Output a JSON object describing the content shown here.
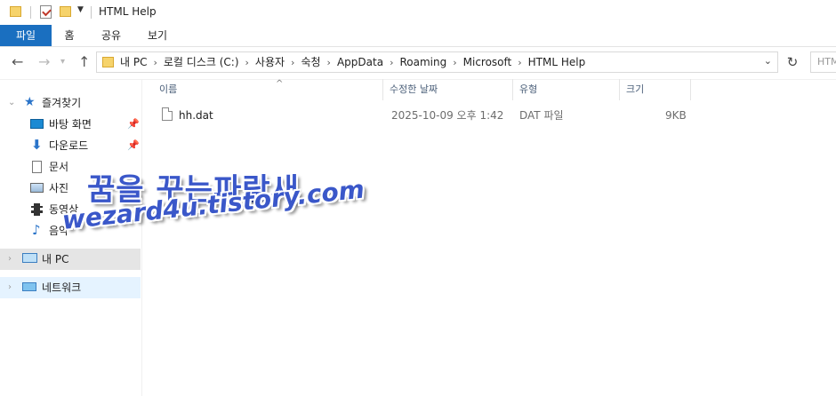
{
  "window": {
    "title": "HTML Help"
  },
  "ribbon": {
    "tabs": [
      "파일",
      "홈",
      "공유",
      "보기"
    ]
  },
  "address": {
    "crumbs": [
      "내 PC",
      "로컬 디스크 (C:)",
      "사용자",
      "숙청",
      "AppData",
      "Roaming",
      "Microsoft",
      "HTML Help"
    ],
    "search_placeholder": "HTML Help 검색"
  },
  "sidebar": {
    "quick_access": "즐겨찾기",
    "items": [
      "바탕 화면",
      "다운로드",
      "문서",
      "사진",
      "동영상",
      "음악"
    ],
    "this_pc": "내 PC",
    "network": "네트워크"
  },
  "columns": {
    "name": "이름",
    "modified": "수정한 날짜",
    "type": "유형",
    "size": "크기"
  },
  "files": [
    {
      "name": "hh.dat",
      "modified": "2025-10-09 오후 1:42",
      "type": "DAT 파일",
      "size": "9KB"
    }
  ],
  "watermark": {
    "line1": "꿈을 꾸는파랑새",
    "line2": "wezard4u.tistory.com"
  },
  "colors": {
    "file_tab": "#1a6fc0",
    "watermark": "#3a57c9",
    "selection": "#e5e5e5"
  }
}
